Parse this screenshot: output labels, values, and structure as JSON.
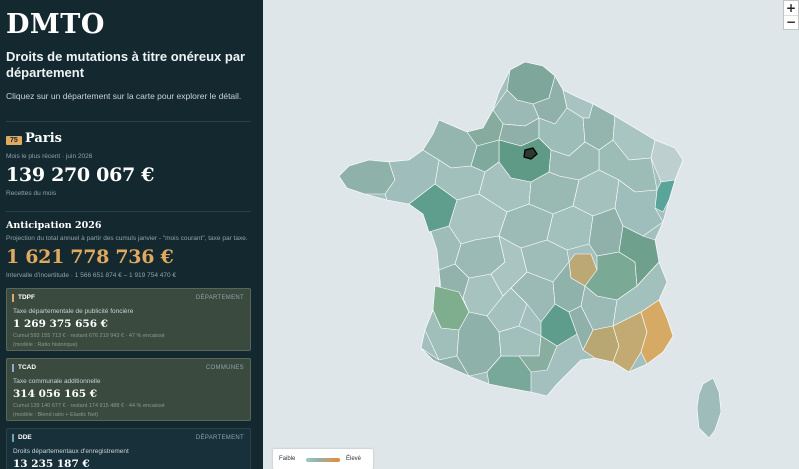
{
  "sidebar": {
    "title": "DMTO",
    "subtitle": "Droits de mutations à titre onéreux par département",
    "intro": "Cliquez sur un département sur la carte pour explorer le détail.",
    "selected": {
      "code": "75",
      "name": "Paris",
      "period_label": "Mois le plus récent · juin 2026",
      "month_value": "139 270 067 €",
      "month_caption": "Recettes du mois"
    },
    "anticipation": {
      "title": "Anticipation 2026",
      "description": "Projection du total annuel à partir des cumuls janvier - \"mois courant\", taxe par taxe.",
      "value": "1 621 778 736 €",
      "interval": "Intervalle d'incertitude · 1 566 651 874 € – 1 919 754 470 €"
    },
    "cards": [
      {
        "tag": "TDPF",
        "scope": "DÉPARTEMENT",
        "title": "Taxe départementale de publicité foncière",
        "value": "1 269 375 656 €",
        "detail": "Cumul 593 155 713 € · restant 676 219 943 € · 47 % encaissé",
        "model": "(modèle : Ratio historique)"
      },
      {
        "tag": "TCAD",
        "scope": "COMMUNES",
        "title": "Taxe communale additionnelle",
        "value": "314 056 165 €",
        "detail": "Cumul 139 140 677 € · restant 174 915 488 € · 44 % encaissé",
        "model": "(modèle : Blend ratio + Elastic Net)"
      },
      {
        "tag": "DDE",
        "scope": "DÉPARTEMENT",
        "title": "Droits départementaux d'enregistrement",
        "value": "13 235 187 €",
        "detail": "",
        "model": ""
      }
    ]
  },
  "map": {
    "zoom_in": "+",
    "zoom_out": "−",
    "legend": {
      "low": "Faible",
      "high": "Élevé"
    },
    "colors": {
      "base": "#9fbcbb",
      "high": "#79a89c",
      "highlight": "#bfae7c",
      "green": "#7fae8e",
      "border": "#ffffff",
      "selected": "#111111"
    }
  }
}
